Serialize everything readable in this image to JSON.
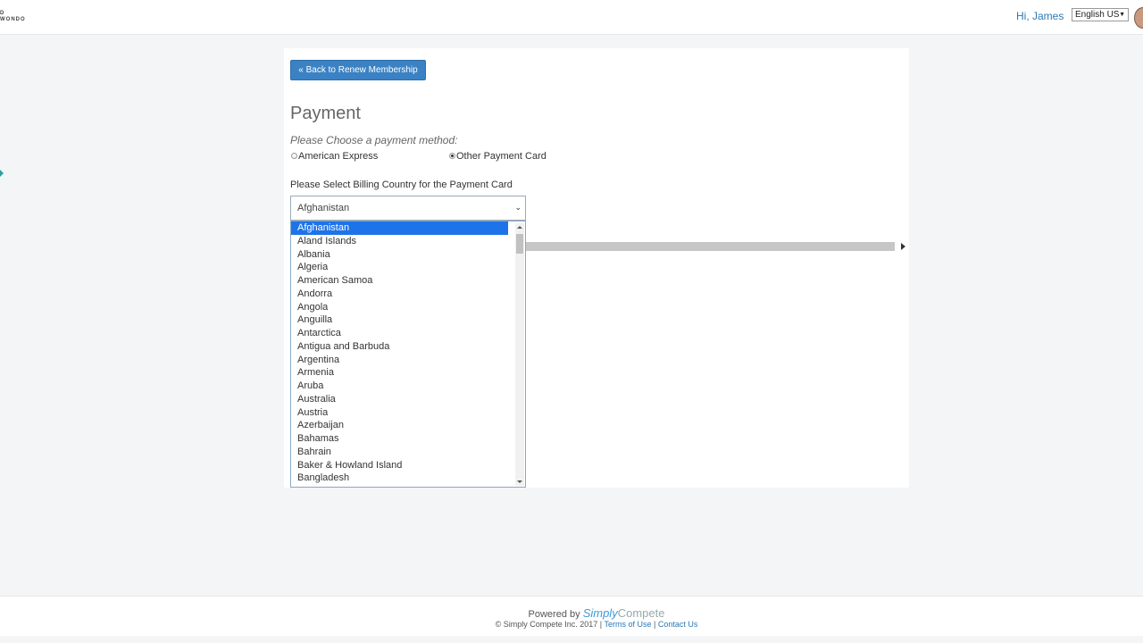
{
  "header": {
    "logo_text": "D\nWONDO",
    "greeting": "Hi, James",
    "language": "English US"
  },
  "back_button": "« Back to Renew Membership",
  "page_title": "Payment",
  "payment_prompt": "Please Choose a payment method:",
  "payment_methods": [
    {
      "label": "American Express",
      "checked": false
    },
    {
      "label": "Other Payment Card",
      "checked": true
    }
  ],
  "country_label": "Please Select Billing Country for the Payment Card",
  "country_select": {
    "value": "Afghanistan",
    "options": [
      "Afghanistan",
      "Aland Islands",
      "Albania",
      "Algeria",
      "American Samoa",
      "Andorra",
      "Angola",
      "Anguilla",
      "Antarctica",
      "Antigua and Barbuda",
      "Argentina",
      "Armenia",
      "Aruba",
      "Australia",
      "Austria",
      "Azerbaijan",
      "Bahamas",
      "Bahrain",
      "Baker & Howland Island",
      "Bangladesh"
    ]
  },
  "footer": {
    "powered_by": "Powered by",
    "brand_a": "Simply",
    "brand_b": "Compete",
    "copyright": "© Simply Compete Inc. 2017 |",
    "terms": "Terms of Use",
    "separator": "|",
    "contact": "Contact Us"
  },
  "colors": {
    "accent": "#3a82c4",
    "link": "#2a78b8",
    "selected_option": "#1e73e8"
  }
}
